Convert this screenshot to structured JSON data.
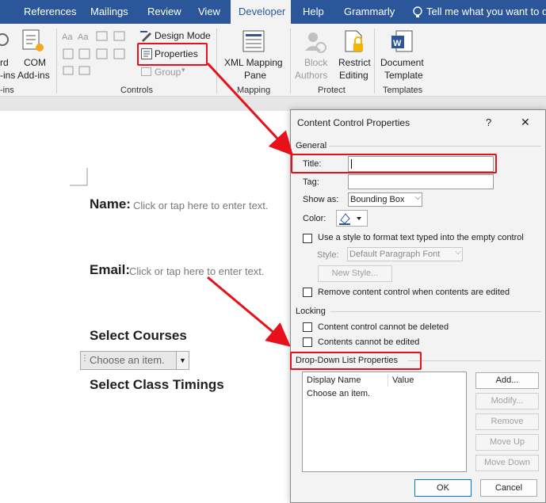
{
  "tabs": [
    "Help",
    "References",
    "Mailings",
    "Review",
    "View",
    "Developer",
    "Grammarly"
  ],
  "tell_me": "Tell me what you want to do",
  "ribbon": {
    "addins_partial": [
      "rd",
      "-ins",
      "-ins"
    ],
    "com_addins": [
      "COM",
      "Add-ins"
    ],
    "design_mode": "Design Mode",
    "properties": "Properties",
    "group": "Group",
    "controls_label": "Controls",
    "xml_mapping": [
      "XML Mapping",
      "Pane"
    ],
    "mapping_label": "Mapping",
    "block_authors": [
      "Block",
      "Authors"
    ],
    "restrict_editing": [
      "Restrict",
      "Editing"
    ],
    "protect_label": "Protect",
    "document_template": [
      "Document",
      "Template"
    ],
    "templates_label": "Templates"
  },
  "document": {
    "name_label": "Name:",
    "name_placeholder": "Click or tap here to enter text.",
    "email_label": "Email:",
    "email_placeholder": "Click or tap here to enter text.",
    "select_courses": "Select Courses",
    "dropdown_value": "Choose an item.",
    "select_timings": "Select Class Timings"
  },
  "dialog": {
    "title": "Content Control Properties",
    "help": "?",
    "close": "✕",
    "general": "General",
    "title_label": "Title:",
    "title_value": "",
    "tag_label": "Tag:",
    "tag_value": "",
    "show_as_label": "Show as:",
    "show_as_value": "Bounding Box",
    "color_label": "Color:",
    "use_style": "Use a style to format text typed into the empty control",
    "style_label": "Style:",
    "style_value": "Default Paragraph Font",
    "new_style": "New Style...",
    "remove_control": "Remove content control when contents are edited",
    "locking": "Locking",
    "cannot_delete": "Content control cannot be deleted",
    "cannot_edit": "Contents cannot be edited",
    "dropdown_props": "Drop-Down List Properties",
    "col_display": "Display Name",
    "col_value": "Value",
    "list_items": [
      {
        "display": "Choose an item.",
        "value": ""
      }
    ],
    "btn_add": "Add...",
    "btn_modify": "Modify...",
    "btn_remove": "Remove",
    "btn_up": "Move Up",
    "btn_down": "Move Down",
    "ok": "OK",
    "cancel": "Cancel"
  },
  "colors": {
    "tab_blue": "#2b579a",
    "highlight_red": "#e8101a"
  }
}
